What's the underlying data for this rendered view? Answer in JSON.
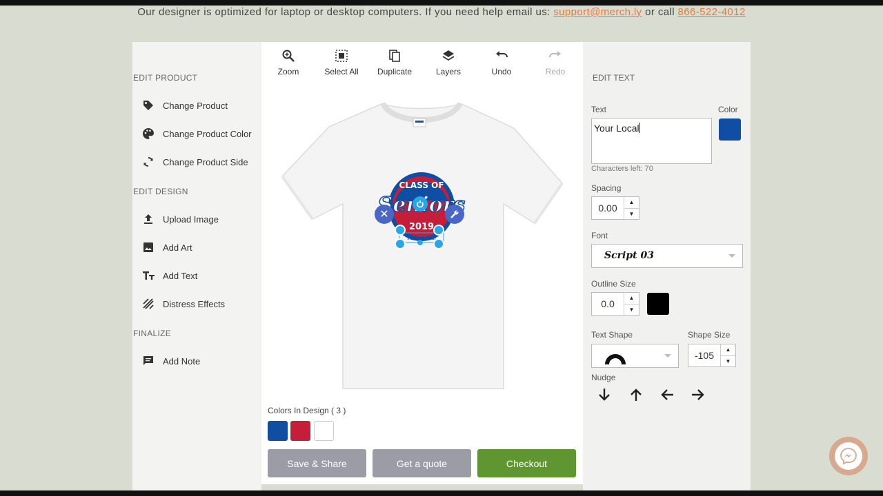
{
  "notice": {
    "text": "Our designer is optimized for laptop or desktop computers. If you need help email us: ",
    "email": "support@merch.ly",
    "middle": " or call ",
    "phone": "866-522-4012"
  },
  "left": {
    "edit_product_title": "EDIT PRODUCT",
    "edit_product": [
      "Change Product",
      "Change Product Color",
      "Change Product Side"
    ],
    "edit_design_title": "EDIT DESIGN",
    "edit_design": [
      "Upload Image",
      "Add Art",
      "Add Text",
      "Distress Effects"
    ],
    "finalize_title": "FINALIZE",
    "finalize": [
      "Add Note"
    ]
  },
  "toolbar": {
    "zoom": "Zoom",
    "select_all": "Select All",
    "duplicate": "Duplicate",
    "layers": "Layers",
    "undo": "Undo",
    "redo": "Redo"
  },
  "design": {
    "line1": "CLASS OF",
    "line2": "Seniors",
    "line3": "2019",
    "line4": "Your Local"
  },
  "colors_in_design": {
    "label": "Colors In Design ( 3 )",
    "swatches": [
      "#0f4ea2",
      "#c41e3a",
      "#ffffff"
    ]
  },
  "actions": {
    "save": "Save & Share",
    "quote": "Get a quote",
    "checkout": "Checkout"
  },
  "edit_text": {
    "title": "EDIT TEXT",
    "text_label": "Text",
    "text_value": "Your Local",
    "color_label": "Color",
    "color": "#0f4ea2",
    "chars_left": "Characters left: 70",
    "spacing_label": "Spacing",
    "spacing_value": "0.00",
    "font_label": "Font",
    "font_value": "Script 03",
    "outline_label": "Outline Size",
    "outline_value": "0.0",
    "outline_color": "#000000",
    "shape_label": "Text Shape",
    "shape_size_label": "Shape Size",
    "shape_size_value": "-105",
    "nudge_label": "Nudge"
  }
}
